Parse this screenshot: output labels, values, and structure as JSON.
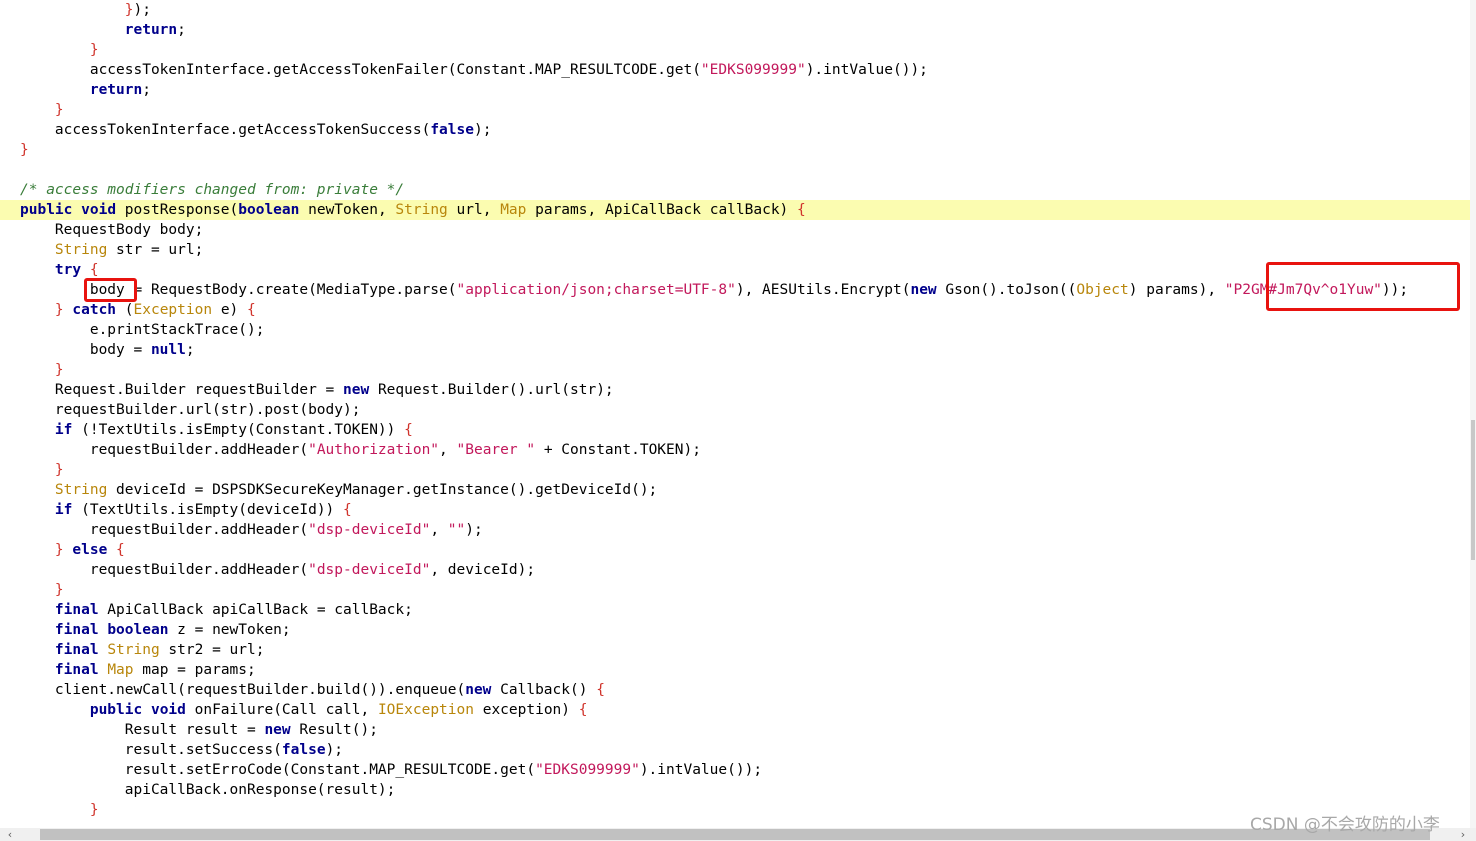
{
  "lines": [
    {
      "tokens": [
        [
          "pl",
          "            "
        ],
        [
          "br",
          "}"
        ],
        [
          "pl",
          ");"
        ]
      ]
    },
    {
      "tokens": [
        [
          "pl",
          "            "
        ],
        [
          "kw",
          "return"
        ],
        [
          "pl",
          ";"
        ]
      ]
    },
    {
      "tokens": [
        [
          "pl",
          "        "
        ],
        [
          "br",
          "}"
        ]
      ]
    },
    {
      "tokens": [
        [
          "pl",
          "        accessTokenInterface.getAccessTokenFailer(Constant.MAP_RESULTCODE.get("
        ],
        [
          "str",
          "\"EDKS099999\""
        ],
        [
          "pl",
          ").intValue());"
        ]
      ]
    },
    {
      "tokens": [
        [
          "pl",
          "        "
        ],
        [
          "kw",
          "return"
        ],
        [
          "pl",
          ";"
        ]
      ]
    },
    {
      "tokens": [
        [
          "pl",
          "    "
        ],
        [
          "br",
          "}"
        ]
      ]
    },
    {
      "tokens": [
        [
          "pl",
          "    accessTokenInterface.getAccessTokenSuccess("
        ],
        [
          "kw",
          "false"
        ],
        [
          "pl",
          ");"
        ]
      ]
    },
    {
      "tokens": [
        [
          "br",
          "}"
        ]
      ]
    },
    {
      "tokens": []
    },
    {
      "tokens": [
        [
          "cmt",
          "/* access modifiers changed from: private */"
        ]
      ]
    },
    {
      "highlight": true,
      "tokens": [
        [
          "kw",
          "public"
        ],
        [
          "pl",
          " "
        ],
        [
          "kw",
          "void"
        ],
        [
          "pl",
          " postResponse("
        ],
        [
          "kw",
          "boolean"
        ],
        [
          "pl",
          " newToken, "
        ],
        [
          "type",
          "String"
        ],
        [
          "pl",
          " url, "
        ],
        [
          "type",
          "Map"
        ],
        [
          "pl",
          " params, ApiCallBack callBack) "
        ],
        [
          "br",
          "{"
        ]
      ]
    },
    {
      "tokens": [
        [
          "pl",
          "    RequestBody body;"
        ]
      ]
    },
    {
      "tokens": [
        [
          "pl",
          "    "
        ],
        [
          "type",
          "String"
        ],
        [
          "pl",
          " str = url;"
        ]
      ]
    },
    {
      "tokens": [
        [
          "pl",
          "    "
        ],
        [
          "kw",
          "try"
        ],
        [
          "pl",
          " "
        ],
        [
          "br",
          "{"
        ]
      ]
    },
    {
      "tokens": [
        [
          "pl",
          "        body = RequestBody.create(MediaType.parse("
        ],
        [
          "str",
          "\"application/json;charset=UTF-8\""
        ],
        [
          "pl",
          "), AESUtils.Encrypt("
        ],
        [
          "kw",
          "new"
        ],
        [
          "pl",
          " Gson().toJson(("
        ],
        [
          "type",
          "Object"
        ],
        [
          "pl",
          ") params), "
        ],
        [
          "str",
          "\"P2GM#Jm7Qv^o1Yuw\""
        ],
        [
          "pl",
          "));"
        ]
      ]
    },
    {
      "tokens": [
        [
          "pl",
          "    "
        ],
        [
          "br",
          "}"
        ],
        [
          "pl",
          " "
        ],
        [
          "kw",
          "catch"
        ],
        [
          "pl",
          " ("
        ],
        [
          "type",
          "Exception"
        ],
        [
          "pl",
          " e) "
        ],
        [
          "br",
          "{"
        ]
      ]
    },
    {
      "tokens": [
        [
          "pl",
          "        e.printStackTrace();"
        ]
      ]
    },
    {
      "tokens": [
        [
          "pl",
          "        body = "
        ],
        [
          "kw",
          "null"
        ],
        [
          "pl",
          ";"
        ]
      ]
    },
    {
      "tokens": [
        [
          "pl",
          "    "
        ],
        [
          "br",
          "}"
        ]
      ]
    },
    {
      "tokens": [
        [
          "pl",
          "    Request.Builder requestBuilder = "
        ],
        [
          "kw",
          "new"
        ],
        [
          "pl",
          " Request.Builder().url(str);"
        ]
      ]
    },
    {
      "tokens": [
        [
          "pl",
          "    requestBuilder.url(str).post(body);"
        ]
      ]
    },
    {
      "tokens": [
        [
          "pl",
          "    "
        ],
        [
          "kw",
          "if"
        ],
        [
          "pl",
          " (!TextUtils.isEmpty(Constant.TOKEN)) "
        ],
        [
          "br",
          "{"
        ]
      ]
    },
    {
      "tokens": [
        [
          "pl",
          "        requestBuilder.addHeader("
        ],
        [
          "str",
          "\"Authorization\""
        ],
        [
          "pl",
          ", "
        ],
        [
          "str",
          "\"Bearer \""
        ],
        [
          "pl",
          " + Constant.TOKEN);"
        ]
      ]
    },
    {
      "tokens": [
        [
          "pl",
          "    "
        ],
        [
          "br",
          "}"
        ]
      ]
    },
    {
      "tokens": [
        [
          "pl",
          "    "
        ],
        [
          "type",
          "String"
        ],
        [
          "pl",
          " deviceId = DSPSDKSecureKeyManager.getInstance().getDeviceId();"
        ]
      ]
    },
    {
      "tokens": [
        [
          "pl",
          "    "
        ],
        [
          "kw",
          "if"
        ],
        [
          "pl",
          " (TextUtils.isEmpty(deviceId)) "
        ],
        [
          "br",
          "{"
        ]
      ]
    },
    {
      "tokens": [
        [
          "pl",
          "        requestBuilder.addHeader("
        ],
        [
          "str",
          "\"dsp-deviceId\""
        ],
        [
          "pl",
          ", "
        ],
        [
          "str",
          "\"\""
        ],
        [
          "pl",
          ");"
        ]
      ]
    },
    {
      "tokens": [
        [
          "pl",
          "    "
        ],
        [
          "br",
          "}"
        ],
        [
          "pl",
          " "
        ],
        [
          "kw",
          "else"
        ],
        [
          "pl",
          " "
        ],
        [
          "br",
          "{"
        ]
      ]
    },
    {
      "tokens": [
        [
          "pl",
          "        requestBuilder.addHeader("
        ],
        [
          "str",
          "\"dsp-deviceId\""
        ],
        [
          "pl",
          ", deviceId);"
        ]
      ]
    },
    {
      "tokens": [
        [
          "pl",
          "    "
        ],
        [
          "br",
          "}"
        ]
      ]
    },
    {
      "tokens": [
        [
          "pl",
          "    "
        ],
        [
          "kw",
          "final"
        ],
        [
          "pl",
          " ApiCallBack apiCallBack = callBack;"
        ]
      ]
    },
    {
      "tokens": [
        [
          "pl",
          "    "
        ],
        [
          "kw",
          "final"
        ],
        [
          "pl",
          " "
        ],
        [
          "kw",
          "boolean"
        ],
        [
          "pl",
          " z = newToken;"
        ]
      ]
    },
    {
      "tokens": [
        [
          "pl",
          "    "
        ],
        [
          "kw",
          "final"
        ],
        [
          "pl",
          " "
        ],
        [
          "type",
          "String"
        ],
        [
          "pl",
          " str2 = url;"
        ]
      ]
    },
    {
      "tokens": [
        [
          "pl",
          "    "
        ],
        [
          "kw",
          "final"
        ],
        [
          "pl",
          " "
        ],
        [
          "type",
          "Map"
        ],
        [
          "pl",
          " map = params;"
        ]
      ]
    },
    {
      "tokens": [
        [
          "pl",
          "    client.newCall(requestBuilder.build()).enqueue("
        ],
        [
          "kw",
          "new"
        ],
        [
          "pl",
          " Callback() "
        ],
        [
          "br",
          "{"
        ]
      ]
    },
    {
      "tokens": [
        [
          "pl",
          "        "
        ],
        [
          "kw",
          "public"
        ],
        [
          "pl",
          " "
        ],
        [
          "kw",
          "void"
        ],
        [
          "pl",
          " onFailure(Call call, "
        ],
        [
          "type",
          "IOException"
        ],
        [
          "pl",
          " exception) "
        ],
        [
          "br",
          "{"
        ]
      ]
    },
    {
      "tokens": [
        [
          "pl",
          "            Result result = "
        ],
        [
          "kw",
          "new"
        ],
        [
          "pl",
          " Result();"
        ]
      ]
    },
    {
      "tokens": [
        [
          "pl",
          "            result.setSuccess("
        ],
        [
          "kw",
          "false"
        ],
        [
          "pl",
          ");"
        ]
      ]
    },
    {
      "tokens": [
        [
          "pl",
          "            result.setErroCode(Constant.MAP_RESULTCODE.get("
        ],
        [
          "str",
          "\"EDKS099999\""
        ],
        [
          "pl",
          ").intValue());"
        ]
      ]
    },
    {
      "tokens": [
        [
          "pl",
          "            apiCallBack.onResponse(result);"
        ]
      ]
    },
    {
      "tokens": [
        [
          "pl",
          "        "
        ],
        [
          "br",
          "}"
        ]
      ]
    }
  ],
  "annotations": [
    {
      "name": "highlight-box-body-variable",
      "label": "body"
    },
    {
      "name": "highlight-box-aes-key",
      "label": "\"P2GM#Jm7Qv^o1Yuw\""
    }
  ],
  "scrollbar": {
    "left_arrow": "‹",
    "right_arrow": "›"
  },
  "watermark": "CSDN @不会攻防的小李",
  "colors": {
    "keyword": "#00008b",
    "string": "#c2185b",
    "type": "#b8860b",
    "comment": "#3a7d3a",
    "bracket": "#d0342c",
    "line_highlight": "#fbfcb0",
    "annotation_box": "#e8130f"
  }
}
